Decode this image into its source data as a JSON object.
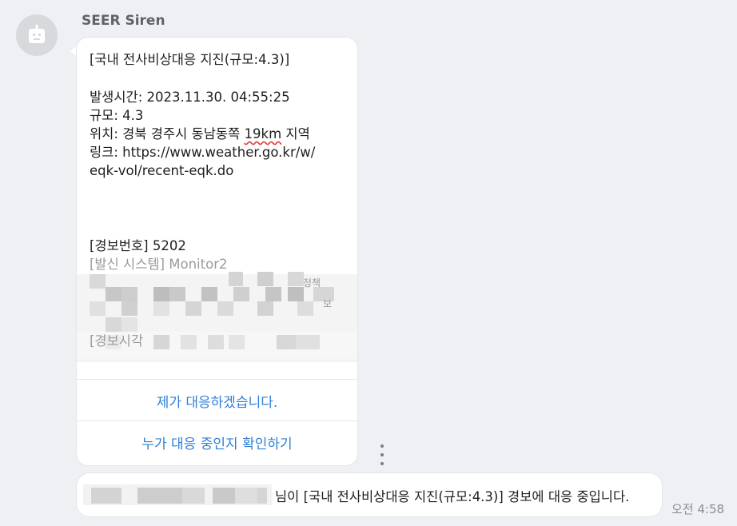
{
  "sender": {
    "name": "SEER Siren",
    "avatar_icon": "robot-icon"
  },
  "message": {
    "title": "[국내 전사비상대응 지진(규모:4.3)]",
    "time_line": "발생시간: 2023.11.30. 04:55:25",
    "magnitude_line": "규모: 4.3",
    "location_prefix": "위치: 경북 경주시 동남동쪽 ",
    "location_distance": "19km",
    "location_suffix": " 지역",
    "link_line1": "링크: https://www.weather.go.kr/w/",
    "link_line2": "eqk-vol/recent-eqk.do",
    "alert_number": "[경보번호] 5202",
    "system_line": "[발신 시스템] Monitor2",
    "partial_label_1": "정책",
    "partial_label_2": "보",
    "partial_label_3": "[경보시각"
  },
  "actions": {
    "respond_label": "제가 대응하겠습니다.",
    "check_label": "누가 대응 중인지 확인하기"
  },
  "reply": {
    "text": "님이 [국내 전사비상대응 지진(규모:4.3)] 경보에 대응 중입니다."
  },
  "timestamp": "오전 4:58",
  "colors": {
    "background": "#eef0f3",
    "bubble": "#ffffff",
    "action_link": "#2d7fd8",
    "spell_underline": "#e23b3b"
  }
}
